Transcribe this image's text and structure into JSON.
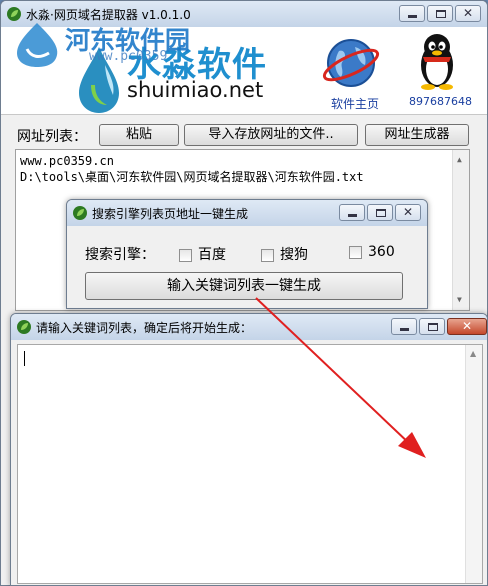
{
  "main": {
    "title": "水淼·网页域名提取器 v1.0.1.0",
    "watermark_text": "河东软件园",
    "watermark_url": "www.pc0359",
    "logo_text": "水淼软件",
    "logo_url": "shuimiao.net",
    "homepage_label": "软件主页",
    "qq_number": "897687648",
    "url_list_label": "网址列表：",
    "paste_button": "粘贴",
    "import_button": "导入存放网址的文件..",
    "generator_button": "网址生成器",
    "url_lines": [
      "www.pc0359.cn",
      "D:\\tools\\桌面\\河东软件园\\网页域名提取器\\河东软件园.txt"
    ]
  },
  "engine_dialog": {
    "title": "搜索引擎列表页地址一键生成",
    "engine_label": "搜索引擎：",
    "options": [
      "百度",
      "搜狗",
      "360"
    ],
    "generate_button": "输入关键词列表一键生成"
  },
  "keyword_dialog": {
    "title": "请输入关键词列表，确定后将开始生成：",
    "text_value": ""
  },
  "colors": {
    "arrow": "#e02020",
    "watermark": "#1e78c8",
    "qq": "#1a3fa0"
  }
}
